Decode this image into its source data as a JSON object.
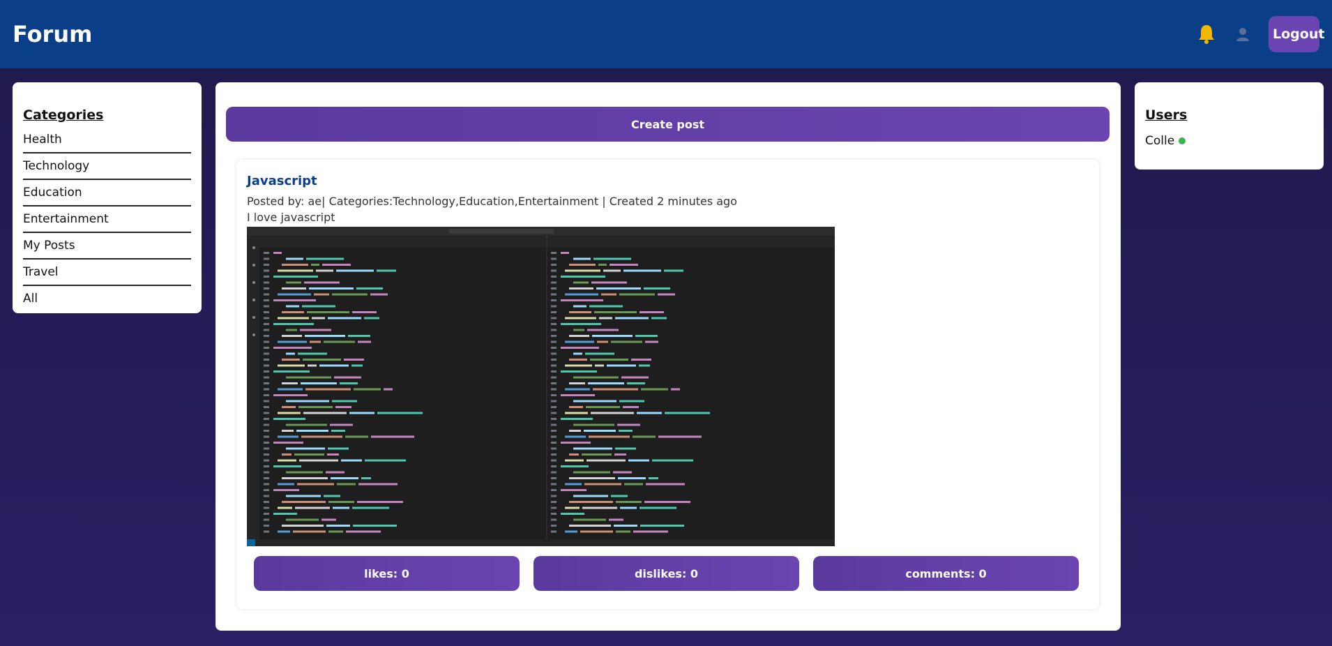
{
  "header": {
    "brand": "Forum",
    "logout_label": "Logout",
    "bell_color": "#f5b800",
    "icons": [
      "bell-icon",
      "user-icon"
    ]
  },
  "categories": {
    "title": "Categories",
    "items": [
      "Health",
      "Technology",
      "Education",
      "Entertainment",
      "My Posts",
      "Travel",
      "All"
    ]
  },
  "main": {
    "create_post_label": "Create post",
    "post": {
      "title": "Javascript",
      "meta": "Posted by: ae| Categories:Technology,Education,Entertainment | Created 2 minutes ago",
      "body": "I love javascript",
      "image_alt": "VS Code screenshot",
      "likes_label": "likes: 0",
      "dislikes_label": "dislikes: 0",
      "comments_label": "comments: 0"
    }
  },
  "users": {
    "title": "Users",
    "list": [
      {
        "name": "Colle",
        "status": "online"
      }
    ]
  },
  "colors": {
    "header_bg": "#0a3f88",
    "button_purple": "#6a44b0",
    "online": "#3cb44b"
  }
}
